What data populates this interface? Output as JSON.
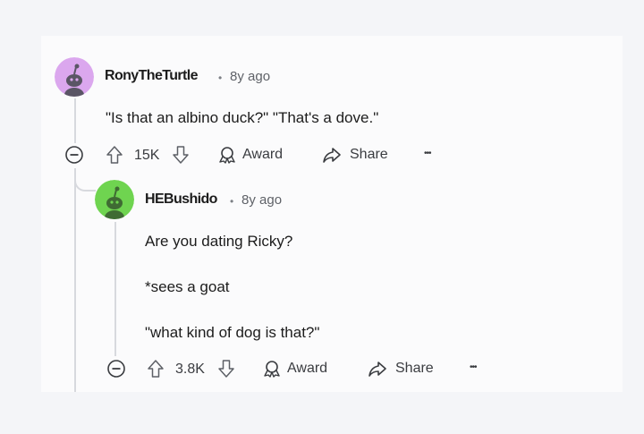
{
  "comments": [
    {
      "username": "RonyTheTurtle",
      "separator": "•",
      "time": "8y ago",
      "lines": [
        "\"Is that an albino duck?\" \"That's a dove.\""
      ],
      "votes": "15K",
      "award_label": "Award",
      "share_label": "Share",
      "more_label": "•••",
      "avatar_color": "#dba7ee"
    },
    {
      "username": "HEBushido",
      "separator": "•",
      "time": "8y ago",
      "lines": [
        "Are you dating Ricky?",
        "*sees a goat",
        "\"what kind of dog is that?\""
      ],
      "votes": "3.8K",
      "award_label": "Award",
      "share_label": "Share",
      "more_label": "•••",
      "avatar_color": "#6fd450"
    }
  ],
  "colors": {
    "background": "#f4f5f8",
    "panel": "#fbfbfc",
    "thread_line": "#d7d9de"
  }
}
